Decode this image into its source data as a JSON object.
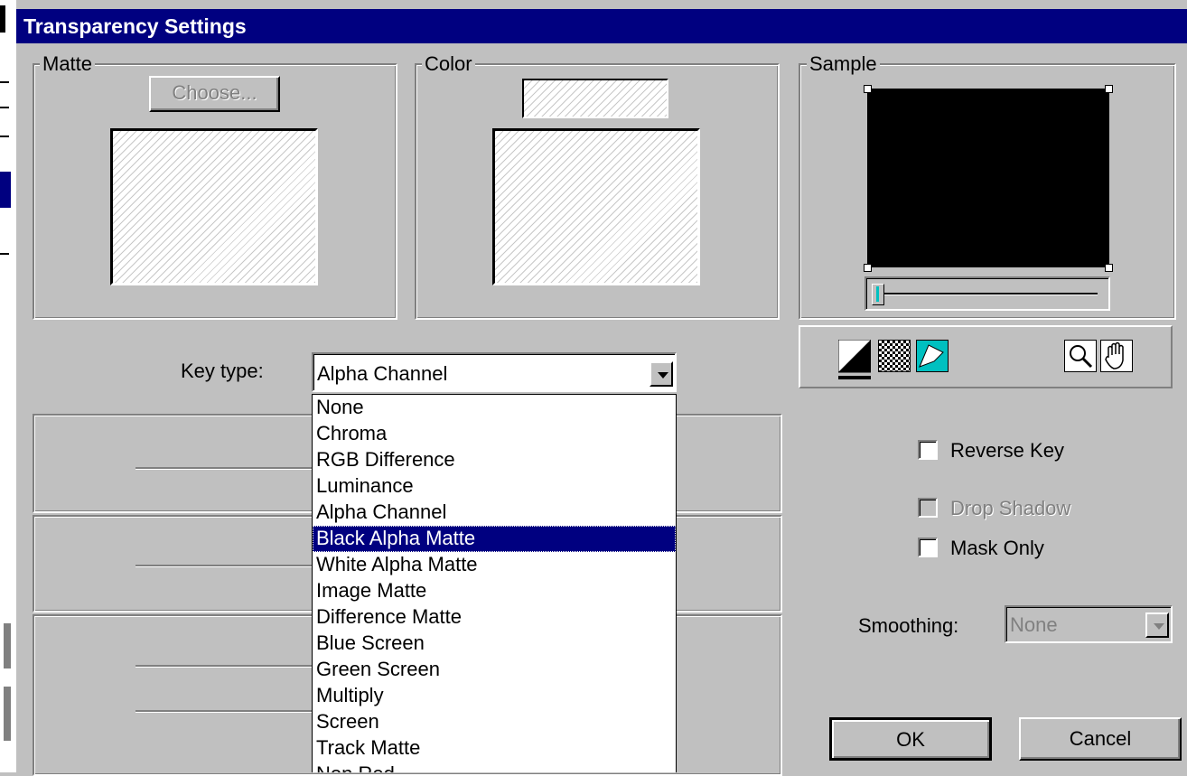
{
  "window": {
    "title": "Transparency Settings"
  },
  "matte": {
    "group_label": "Matte",
    "choose_button": "Choose..."
  },
  "color": {
    "group_label": "Color"
  },
  "sample": {
    "group_label": "Sample"
  },
  "key_type": {
    "label": "Key type:",
    "selected": "Alpha Channel",
    "options": [
      "None",
      "Chroma",
      "RGB Difference",
      "Luminance",
      "Alpha Channel",
      "Black Alpha Matte",
      "White Alpha Matte",
      "Image Matte",
      "Difference Matte",
      "Blue Screen",
      "Green Screen",
      "Multiply",
      "Screen",
      "Track Matte",
      "Non Red"
    ],
    "highlighted": "Black Alpha Matte"
  },
  "options": {
    "reverse_key": "Reverse Key",
    "drop_shadow": "Drop Shadow",
    "mask_only": "Mask Only"
  },
  "smoothing": {
    "label": "Smoothing:",
    "value": "None"
  },
  "buttons": {
    "ok": "OK",
    "cancel": "Cancel"
  },
  "colors": {
    "titlebar": "#000080",
    "face": "#c0c0c0",
    "highlight": "#000080",
    "teal": "#00c0c0"
  }
}
